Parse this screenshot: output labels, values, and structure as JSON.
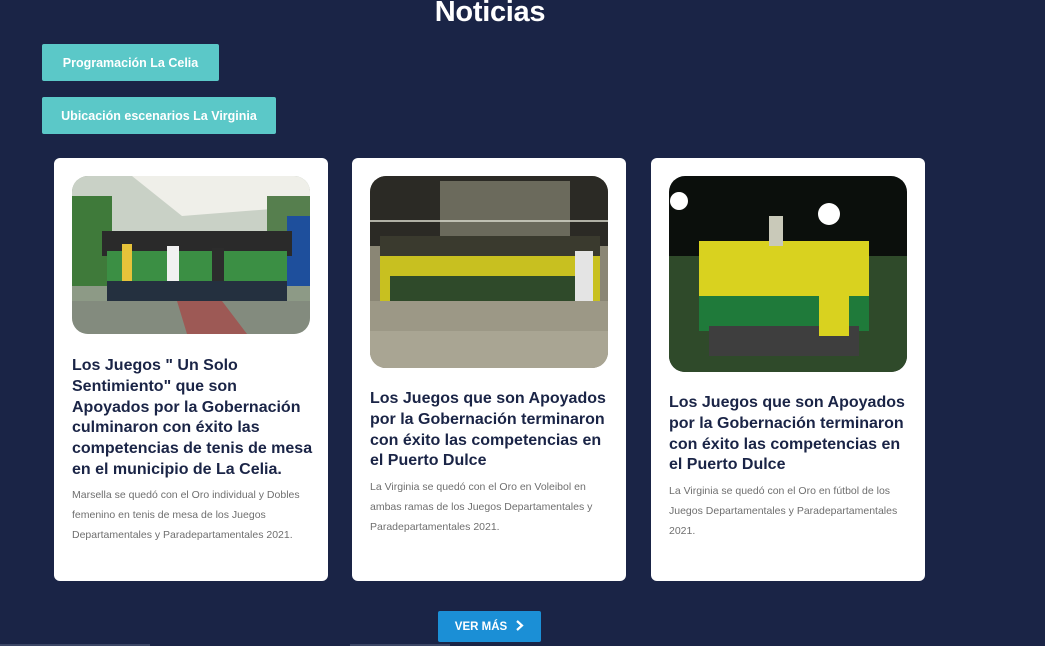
{
  "section": {
    "title": "Noticias"
  },
  "links": [
    {
      "label": "Programación La Celia"
    },
    {
      "label": "Ubicación escenarios La Virginia"
    }
  ],
  "cards": [
    {
      "title": "Los Juegos \" Un Solo Sentimiento\" que son Apoyados por la Gobernación culminaron con éxito las competencias de tenis de mesa en el municipio de La Celia.",
      "excerpt": "Marsella se quedó con el Oro individual y Dobles femenino en tenis de mesa de los Juegos Departamentales y Paradepartamentales 2021."
    },
    {
      "title": "Los Juegos que son Apoyados por la Gobernación terminaron con éxito las competencias en el Puerto Dulce",
      "excerpt": "La Virginia se quedó con el Oro en Voleibol en ambas ramas de los Juegos Departamentales y Paradepartamentales 2021."
    },
    {
      "title": "Los Juegos que son Apoyados por la Gobernación terminaron con éxito las competencias en el Puerto Dulce",
      "excerpt": "La Virginia se quedó con el Oro en fútbol de los Juegos Departamentales y Paradepartamentales 2021."
    }
  ],
  "more_button": {
    "label": "VER MÁS",
    "icon": "chevron-right-icon"
  },
  "colors": {
    "background": "#1a2446",
    "teal_button": "#5bc8c8",
    "blue_button": "#1b8fd6",
    "title_text": "#1a2446"
  }
}
